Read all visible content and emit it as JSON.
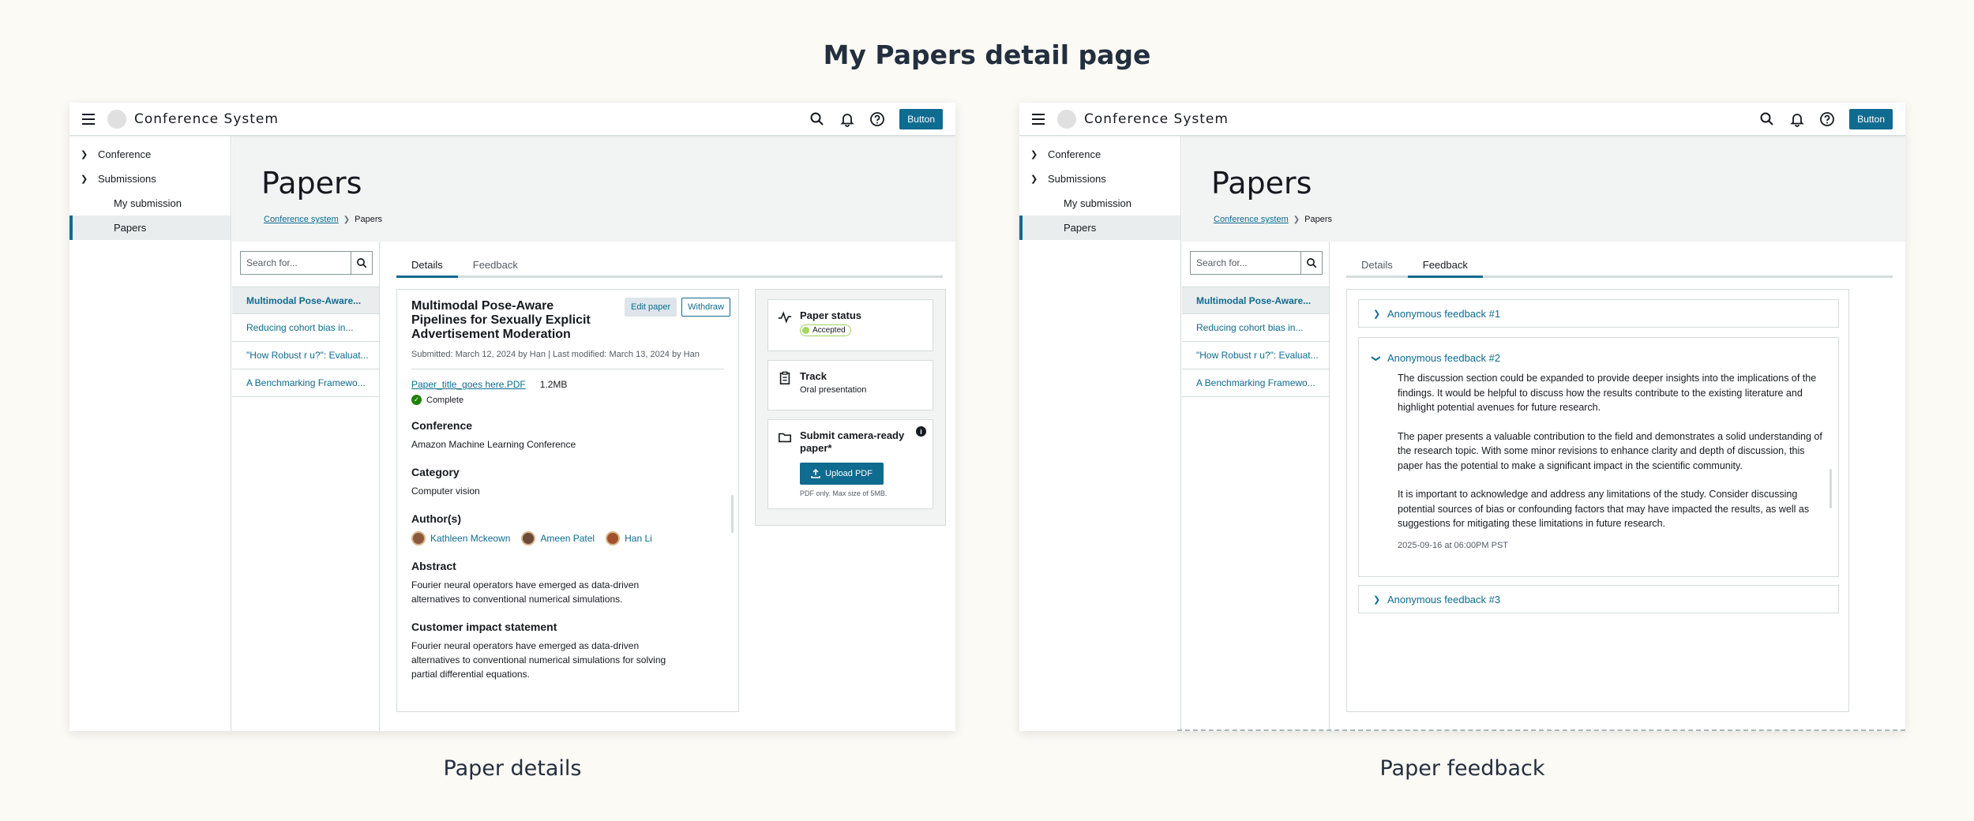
{
  "page_title": "My Papers detail page",
  "captions": {
    "left": "Paper details",
    "right": "Paper feedback"
  },
  "nav": {
    "brand": "Conference System",
    "button": "Button"
  },
  "sidebar": {
    "items": [
      {
        "label": "Conference"
      },
      {
        "label": "Submissions"
      },
      {
        "label": "My submission"
      },
      {
        "label": "Papers"
      }
    ]
  },
  "header": {
    "title": "Papers",
    "breadcrumb_link": "Conference system",
    "breadcrumb_current": "Papers"
  },
  "search": {
    "placeholder": "Search for..."
  },
  "papers": [
    "Multimodal Pose-Aware...",
    "Reducing cohort bias in...",
    "\"How Robust r u?\": Evaluat...",
    "A Benchmarking Framewo..."
  ],
  "tabs": {
    "details": "Details",
    "feedback": "Feedback"
  },
  "details": {
    "title": "Multimodal Pose-Aware Pipelines for Sexually Explicit Advertisement Moderation",
    "edit_button": "Edit paper",
    "withdraw_button": "Withdraw",
    "meta": "Submitted: March 12, 2024 by Han | Last modified: March 13, 2024 by Han",
    "file_name": "Paper_title_goes here.PDF",
    "file_size": "1.2MB",
    "file_status": "Complete",
    "conference_h": "Conference",
    "conference_v": "Amazon Machine Learning Conference",
    "category_h": "Category",
    "category_v": "Computer vision",
    "authors_h": "Author(s)",
    "authors": [
      "Kathleen Mckeown",
      "Ameen Patel",
      "Han Li"
    ],
    "abstract_h": "Abstract",
    "abstract_v": "Fourier neural operators have emerged as data-driven alternatives to  conventional numerical simulations.",
    "impact_h": "Customer impact statement",
    "impact_v": "Fourier neural operators have emerged as data-driven alternatives to  conventional numerical simulations for solving partial differential equations."
  },
  "status": {
    "paper_status_h": "Paper status",
    "paper_status_v": "Accepted",
    "track_h": "Track",
    "track_v": "Oral presentation",
    "submit_h": "Submit camera-ready paper*",
    "upload_button": "Upload PDF",
    "upload_hint": "PDF only. Max size of 5MB."
  },
  "feedback": {
    "items": [
      {
        "title": "Anonymous feedback #1"
      },
      {
        "title": "Anonymous feedback #2",
        "paragraphs": [
          "The discussion section could be expanded to provide deeper insights into the implications of the findings. It would be helpful to discuss how the results contribute to the existing literature and highlight potential avenues for future research.",
          "The paper presents a valuable contribution to the field and demonstrates a solid understanding of the research topic. With some minor revisions to enhance clarity and depth of discussion, this paper has the potential to make a significant impact in the scientific community.",
          "It is important to acknowledge and address any limitations of the study. Consider discussing potential sources of bias or confounding factors that may have impacted the results, as well as suggestions for mitigating these limitations in future research."
        ],
        "timestamp": "2025-09-16 at 06:00PM PST"
      },
      {
        "title": "Anonymous feedback #3"
      }
    ]
  },
  "colors": {
    "accent": "#0f6b8f",
    "success": "#1d8102",
    "badge": "#a4d65e"
  },
  "icons": [
    "menu-icon",
    "search-icon",
    "bell-icon",
    "help-icon",
    "chevron-right-icon",
    "chevron-down-icon",
    "activity-icon",
    "clipboard-icon",
    "folder-icon",
    "upload-icon",
    "info-icon",
    "check-circle-icon"
  ]
}
